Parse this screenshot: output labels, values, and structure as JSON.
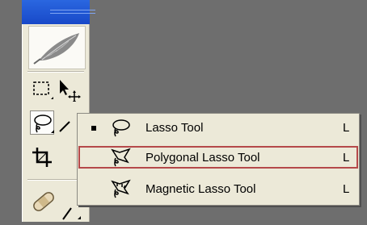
{
  "toolbox": {
    "tools": [
      {
        "name": "rectangular-marquee",
        "icon": "rectangular-marquee-icon"
      },
      {
        "name": "move",
        "icon": "move-icon"
      },
      {
        "name": "lasso",
        "icon": "lasso-icon",
        "active": true
      },
      {
        "name": "magic-wand",
        "icon": "magic-wand-icon"
      },
      {
        "name": "crop",
        "icon": "crop-icon"
      },
      {
        "name": "healing-brush",
        "icon": "healing-brush-icon"
      }
    ]
  },
  "flyout_menu": {
    "items": [
      {
        "label": "Lasso Tool",
        "shortcut": "L",
        "icon": "lasso-icon",
        "current": true
      },
      {
        "label": "Polygonal Lasso Tool",
        "shortcut": "L",
        "icon": "polygonal-lasso-icon",
        "highlighted": true
      },
      {
        "label": "Magnetic Lasso Tool",
        "shortcut": "L",
        "icon": "magnetic-lasso-icon"
      }
    ],
    "highlight_color": "#b5494a"
  }
}
